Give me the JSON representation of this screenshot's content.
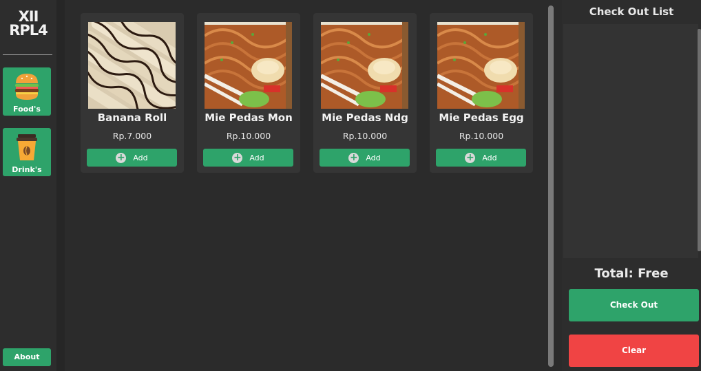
{
  "sidebar": {
    "logo_line1": "XII",
    "logo_line2": "RPL4",
    "items": [
      {
        "label": "Food's",
        "icon": "burger-icon"
      },
      {
        "label": "Drink's",
        "icon": "coffee-cup-icon"
      }
    ],
    "about_label": "About"
  },
  "products": [
    {
      "name": "Banana Roll",
      "price": "Rp.7.000",
      "add_label": "Add",
      "image": "banana-roll-image"
    },
    {
      "name": "Mie Pedas Mon",
      "price": "Rp.10.000",
      "add_label": "Add",
      "image": "noodle-image"
    },
    {
      "name": "Mie Pedas Ndg",
      "price": "Rp.10.000",
      "add_label": "Add",
      "image": "noodle-image"
    },
    {
      "name": "Mie Pedas Egg",
      "price": "Rp.10.000",
      "add_label": "Add",
      "image": "noodle-image"
    }
  ],
  "checkout": {
    "title": "Check Out List",
    "total": "Total: Free",
    "checkout_label": "Check Out",
    "clear_label": "Clear"
  },
  "colors": {
    "accent": "#2ea36a",
    "danger": "#f04444",
    "background": "#2b2b2b"
  }
}
